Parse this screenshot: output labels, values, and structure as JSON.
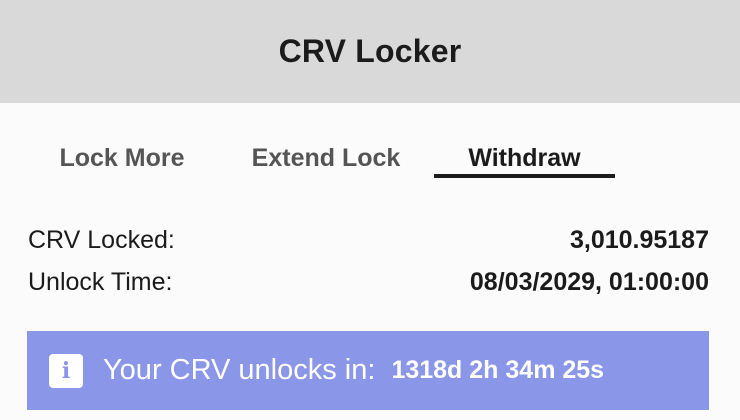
{
  "header": {
    "title": "CRV Locker"
  },
  "tabs": [
    {
      "label": "Lock More",
      "active": false
    },
    {
      "label": "Extend Lock",
      "active": false
    },
    {
      "label": "Withdraw",
      "active": true
    }
  ],
  "details": {
    "crv_locked_label": "CRV Locked:",
    "crv_locked_value": "3,010.95187",
    "unlock_time_label": "Unlock Time:",
    "unlock_time_value": "08/03/2029, 01:00:00"
  },
  "info": {
    "icon": "info-icon",
    "icon_glyph": "i",
    "message": "Your CRV unlocks in:",
    "countdown": "1318d 2h 34m 25s",
    "background_color": "#8a96e8"
  },
  "colors": {
    "header_bg": "#d9d9d9",
    "page_bg": "#fbfbfb",
    "text": "#1b1b1b"
  }
}
